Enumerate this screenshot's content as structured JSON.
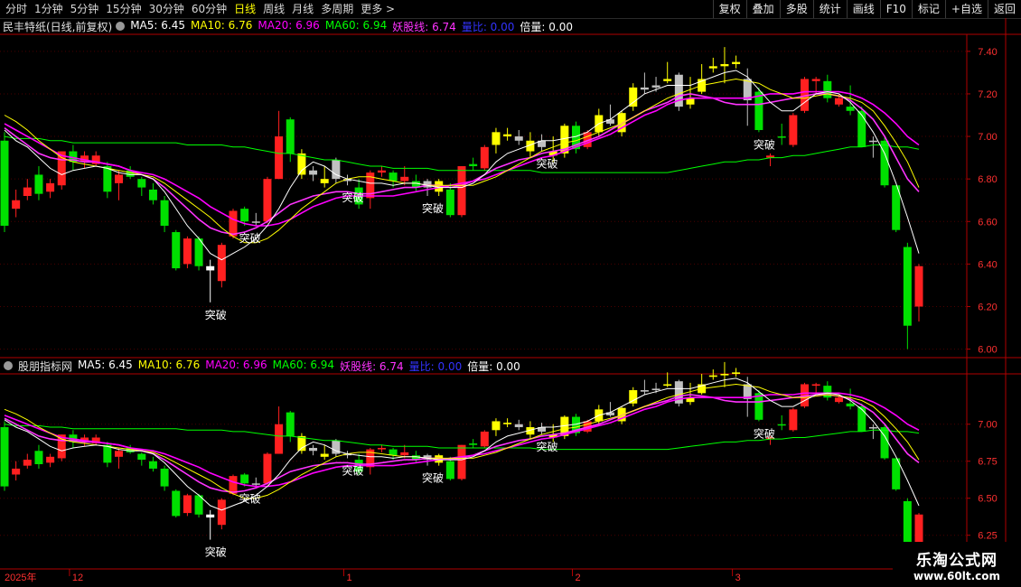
{
  "toolbar": {
    "periods": [
      "分时",
      "1分钟",
      "5分钟",
      "15分钟",
      "30分钟",
      "60分钟",
      "日线",
      "周线",
      "月线",
      "多周期",
      "更多 >"
    ],
    "active_period": "日线",
    "right_buttons": [
      "复权",
      "叠加",
      "多股",
      "统计",
      "画线",
      "F10",
      "标记",
      "+自选",
      "返回"
    ]
  },
  "main_legend": {
    "title": "民丰特纸(日线,前复权)",
    "items": [
      {
        "text": "MA5: 6.45",
        "color": "#ffffff"
      },
      {
        "text": "MA10: 6.76",
        "color": "#ffff00"
      },
      {
        "text": "MA20: 6.96",
        "color": "#ff00ff"
      },
      {
        "text": "MA60: 6.94",
        "color": "#00ff00"
      },
      {
        "text": "妖股线: 6.74",
        "color": "#ff33ff"
      },
      {
        "text": "量比: 0.00",
        "color": "#3333ff"
      },
      {
        "text": "倍量: 0.00",
        "color": "#ffffff"
      }
    ]
  },
  "sub_legend": {
    "title": "股朋指标网",
    "items": [
      {
        "text": "MA5: 6.45",
        "color": "#ffffff"
      },
      {
        "text": "MA10: 6.76",
        "color": "#ffff00"
      },
      {
        "text": "MA20: 6.96",
        "color": "#ff00ff"
      },
      {
        "text": "MA60: 6.94",
        "color": "#00ff00"
      },
      {
        "text": "妖股线: 6.74",
        "color": "#ff33ff"
      },
      {
        "text": "量比: 0.00",
        "color": "#3333ff"
      },
      {
        "text": "倍量: 0.00",
        "color": "#ffffff"
      }
    ]
  },
  "signal_label": "突破",
  "x_axis": {
    "year_label": "2025年",
    "month_labels": [
      "12",
      "1",
      "2",
      "3"
    ]
  },
  "watermark": {
    "line1": "乐淘公式网",
    "line2": "www.60lt.com"
  },
  "colors": {
    "up": "#ff2020",
    "down": "#00e000",
    "neutral": "#c0c0c0",
    "yellow": "#ffff00",
    "axis": "#b00000"
  },
  "chart_data": {
    "type": "candlestick",
    "main_axis": {
      "ticks": [
        7.4,
        7.2,
        7.0,
        6.8,
        6.6,
        6.4,
        6.2,
        6.0
      ],
      "ylim": [
        5.96,
        7.48
      ]
    },
    "sub_axis": {
      "ticks": [
        7.0,
        6.75,
        6.5,
        6.25
      ]
    },
    "price_labels": [
      "7.40",
      "7.20",
      "7.00",
      "6.80",
      "6.60",
      "6.40",
      "6.20",
      "6.00"
    ],
    "sub_price_labels": [
      "7.00",
      "6.75",
      "6.50",
      "6.25"
    ],
    "candles": [
      {
        "o": 6.98,
        "h": 7.02,
        "l": 6.55,
        "c": 6.58,
        "k": "down"
      },
      {
        "o": 6.66,
        "h": 6.75,
        "l": 6.62,
        "c": 6.7,
        "k": "up"
      },
      {
        "o": 6.76,
        "h": 6.8,
        "l": 6.7,
        "c": 6.72,
        "k": "up"
      },
      {
        "o": 6.82,
        "h": 6.86,
        "l": 6.7,
        "c": 6.73,
        "k": "down"
      },
      {
        "o": 6.74,
        "h": 6.8,
        "l": 6.71,
        "c": 6.78,
        "k": "up"
      },
      {
        "o": 6.77,
        "h": 6.93,
        "l": 6.75,
        "c": 6.93,
        "k": "up"
      },
      {
        "o": 6.93,
        "h": 6.96,
        "l": 6.84,
        "c": 6.88,
        "k": "down"
      },
      {
        "o": 6.88,
        "h": 6.93,
        "l": 6.85,
        "c": 6.91,
        "k": "up"
      },
      {
        "o": 6.91,
        "h": 6.93,
        "l": 6.86,
        "c": 6.87,
        "k": "up"
      },
      {
        "o": 6.86,
        "h": 6.88,
        "l": 6.71,
        "c": 6.74,
        "k": "down"
      },
      {
        "o": 6.78,
        "h": 6.84,
        "l": 6.7,
        "c": 6.82,
        "k": "up"
      },
      {
        "o": 6.84,
        "h": 6.86,
        "l": 6.8,
        "c": 6.81,
        "k": "down"
      },
      {
        "o": 6.8,
        "h": 6.81,
        "l": 6.72,
        "c": 6.76,
        "k": "down"
      },
      {
        "o": 6.75,
        "h": 6.78,
        "l": 6.68,
        "c": 6.7,
        "k": "down"
      },
      {
        "o": 6.7,
        "h": 6.72,
        "l": 6.55,
        "c": 6.58,
        "k": "down"
      },
      {
        "o": 6.55,
        "h": 6.56,
        "l": 6.37,
        "c": 6.38,
        "k": "down"
      },
      {
        "o": 6.4,
        "h": 6.53,
        "l": 6.38,
        "c": 6.52,
        "k": "up"
      },
      {
        "o": 6.52,
        "h": 6.53,
        "l": 6.37,
        "c": 6.39,
        "k": "down"
      },
      {
        "o": 6.39,
        "h": 6.42,
        "l": 6.22,
        "c": 6.37,
        "k": "white"
      },
      {
        "o": 6.32,
        "h": 6.5,
        "l": 6.29,
        "c": 6.49,
        "k": "up"
      },
      {
        "o": 6.53,
        "h": 6.66,
        "l": 6.52,
        "c": 6.65,
        "k": "up"
      },
      {
        "o": 6.66,
        "h": 6.67,
        "l": 6.58,
        "c": 6.6,
        "k": "down"
      },
      {
        "o": 6.6,
        "h": 6.64,
        "l": 6.58,
        "c": 6.6,
        "k": "neutral"
      },
      {
        "o": 6.6,
        "h": 6.81,
        "l": 6.59,
        "c": 6.8,
        "k": "up"
      },
      {
        "o": 6.8,
        "h": 7.12,
        "l": 6.8,
        "c": 7.0,
        "k": "up"
      },
      {
        "o": 7.08,
        "h": 7.09,
        "l": 6.88,
        "c": 6.92,
        "k": "down"
      },
      {
        "o": 6.92,
        "h": 6.94,
        "l": 6.8,
        "c": 6.82,
        "k": "yellow"
      },
      {
        "o": 6.82,
        "h": 6.86,
        "l": 6.79,
        "c": 6.84,
        "k": "neutral"
      },
      {
        "o": 6.8,
        "h": 6.86,
        "l": 6.76,
        "c": 6.78,
        "k": "yellow"
      },
      {
        "o": 6.89,
        "h": 6.9,
        "l": 6.78,
        "c": 6.8,
        "k": "neutral"
      },
      {
        "o": 6.79,
        "h": 6.82,
        "l": 6.77,
        "c": 6.8,
        "k": "neutral"
      },
      {
        "o": 6.76,
        "h": 6.8,
        "l": 6.66,
        "c": 6.68,
        "k": "down"
      },
      {
        "o": 6.71,
        "h": 6.84,
        "l": 6.66,
        "c": 6.83,
        "k": "up"
      },
      {
        "o": 6.84,
        "h": 6.86,
        "l": 6.81,
        "c": 6.83,
        "k": "up"
      },
      {
        "o": 6.83,
        "h": 6.84,
        "l": 6.76,
        "c": 6.79,
        "k": "down"
      },
      {
        "o": 6.81,
        "h": 6.86,
        "l": 6.77,
        "c": 6.79,
        "k": "up"
      },
      {
        "o": 6.79,
        "h": 6.82,
        "l": 6.74,
        "c": 6.76,
        "k": "down"
      },
      {
        "o": 6.76,
        "h": 6.8,
        "l": 6.72,
        "c": 6.79,
        "k": "neutral"
      },
      {
        "o": 6.79,
        "h": 6.8,
        "l": 6.72,
        "c": 6.74,
        "k": "yellow"
      },
      {
        "o": 6.75,
        "h": 6.78,
        "l": 6.62,
        "c": 6.63,
        "k": "down"
      },
      {
        "o": 6.63,
        "h": 6.86,
        "l": 6.62,
        "c": 6.86,
        "k": "up"
      },
      {
        "o": 6.87,
        "h": 6.9,
        "l": 6.84,
        "c": 6.86,
        "k": "down"
      },
      {
        "o": 6.85,
        "h": 6.96,
        "l": 6.84,
        "c": 6.95,
        "k": "up"
      },
      {
        "o": 6.96,
        "h": 7.04,
        "l": 6.92,
        "c": 7.02,
        "k": "yellow"
      },
      {
        "o": 7.01,
        "h": 7.04,
        "l": 6.98,
        "c": 7.0,
        "k": "yellow"
      },
      {
        "o": 7.0,
        "h": 7.03,
        "l": 6.96,
        "c": 6.98,
        "k": "neutral"
      },
      {
        "o": 6.98,
        "h": 7.02,
        "l": 6.9,
        "c": 6.93,
        "k": "yellow"
      },
      {
        "o": 6.95,
        "h": 7.01,
        "l": 6.93,
        "c": 6.98,
        "k": "neutral"
      },
      {
        "o": 6.93,
        "h": 7.0,
        "l": 6.88,
        "c": 6.91,
        "k": "yellow"
      },
      {
        "o": 6.92,
        "h": 7.06,
        "l": 6.9,
        "c": 7.05,
        "k": "yellow"
      },
      {
        "o": 7.05,
        "h": 7.07,
        "l": 6.92,
        "c": 6.94,
        "k": "down"
      },
      {
        "o": 6.95,
        "h": 7.03,
        "l": 6.94,
        "c": 7.02,
        "k": "up"
      },
      {
        "o": 7.02,
        "h": 7.13,
        "l": 7.0,
        "c": 7.1,
        "k": "yellow"
      },
      {
        "o": 7.08,
        "h": 7.15,
        "l": 7.05,
        "c": 7.06,
        "k": "neutral"
      },
      {
        "o": 7.02,
        "h": 7.12,
        "l": 7.0,
        "c": 7.11,
        "k": "yellow"
      },
      {
        "o": 7.14,
        "h": 7.25,
        "l": 7.12,
        "c": 7.23,
        "k": "yellow"
      },
      {
        "o": 7.23,
        "h": 7.3,
        "l": 7.2,
        "c": 7.22,
        "k": "neutral"
      },
      {
        "o": 7.23,
        "h": 7.28,
        "l": 7.21,
        "c": 7.24,
        "k": "neutral"
      },
      {
        "o": 7.26,
        "h": 7.35,
        "l": 7.25,
        "c": 7.27,
        "k": "yellow"
      },
      {
        "o": 7.29,
        "h": 7.3,
        "l": 7.12,
        "c": 7.14,
        "k": "neutral"
      },
      {
        "o": 7.15,
        "h": 7.28,
        "l": 7.13,
        "c": 7.18,
        "k": "yellow"
      },
      {
        "o": 7.21,
        "h": 7.34,
        "l": 7.2,
        "c": 7.27,
        "k": "yellow"
      },
      {
        "o": 7.32,
        "h": 7.37,
        "l": 7.3,
        "c": 7.33,
        "k": "yellow"
      },
      {
        "o": 7.33,
        "h": 7.42,
        "l": 7.25,
        "c": 7.34,
        "k": "yellow"
      },
      {
        "o": 7.34,
        "h": 7.38,
        "l": 7.32,
        "c": 7.35,
        "k": "yellow"
      },
      {
        "o": 7.27,
        "h": 7.32,
        "l": 7.05,
        "c": 7.17,
        "k": "neutral"
      },
      {
        "o": 7.21,
        "h": 7.23,
        "l": 7.02,
        "c": 7.03,
        "k": "down"
      },
      {
        "o": 6.91,
        "h": 6.92,
        "l": 6.86,
        "c": 6.9,
        "k": "up"
      },
      {
        "o": 7.0,
        "h": 7.06,
        "l": 6.96,
        "c": 7.0,
        "k": "down"
      },
      {
        "o": 6.96,
        "h": 7.11,
        "l": 6.95,
        "c": 7.1,
        "k": "up"
      },
      {
        "o": 7.12,
        "h": 7.28,
        "l": 7.11,
        "c": 7.27,
        "k": "up"
      },
      {
        "o": 7.26,
        "h": 7.28,
        "l": 7.2,
        "c": 7.27,
        "k": "up"
      },
      {
        "o": 7.26,
        "h": 7.29,
        "l": 7.16,
        "c": 7.18,
        "k": "down"
      },
      {
        "o": 7.18,
        "h": 7.2,
        "l": 7.14,
        "c": 7.15,
        "k": "up"
      },
      {
        "o": 7.14,
        "h": 7.24,
        "l": 7.1,
        "c": 7.12,
        "k": "down"
      },
      {
        "o": 7.12,
        "h": 7.14,
        "l": 6.95,
        "c": 6.95,
        "k": "down"
      },
      {
        "o": 6.98,
        "h": 7.0,
        "l": 6.9,
        "c": 6.98,
        "k": "neutral"
      },
      {
        "o": 6.98,
        "h": 7.0,
        "l": 6.76,
        "c": 6.77,
        "k": "down"
      },
      {
        "o": 6.77,
        "h": 6.77,
        "l": 6.55,
        "c": 6.56,
        "k": "down"
      },
      {
        "o": 6.48,
        "h": 6.5,
        "l": 6.0,
        "c": 6.11,
        "k": "down"
      },
      {
        "o": 6.2,
        "h": 6.4,
        "l": 6.13,
        "c": 6.39,
        "k": "up"
      }
    ],
    "signals_at_candle": [
      18,
      21,
      30,
      37,
      47,
      66
    ],
    "lines": {
      "ma5": {
        "color": "#ffffff",
        "values": [
          7.03,
          6.98,
          6.95,
          6.9,
          6.85,
          6.82,
          6.84,
          6.85,
          6.86,
          6.85,
          6.83,
          6.82,
          6.82,
          6.8,
          6.74,
          6.66,
          6.58,
          6.52,
          6.45,
          6.42,
          6.45,
          6.48,
          6.52,
          6.58,
          6.66,
          6.76,
          6.84,
          6.88,
          6.86,
          6.82,
          6.8,
          6.79,
          6.78,
          6.78,
          6.77,
          6.78,
          6.78,
          6.77,
          6.76,
          6.76,
          6.76,
          6.78,
          6.82,
          6.88,
          6.92,
          6.94,
          6.96,
          6.98,
          6.98,
          6.99,
          7.0,
          7.02,
          7.06,
          7.08,
          7.12,
          7.16,
          7.2,
          7.22,
          7.24,
          7.24,
          7.24,
          7.26,
          7.28,
          7.3,
          7.31,
          7.28,
          7.22,
          7.16,
          7.12,
          7.12,
          7.16,
          7.2,
          7.21,
          7.2,
          7.16,
          7.1,
          7.02,
          6.92,
          6.78,
          6.62,
          6.45
        ]
      },
      "ma10": {
        "color": "#ffff00",
        "values": [
          7.1,
          7.07,
          7.03,
          6.98,
          6.94,
          6.9,
          6.88,
          6.87,
          6.86,
          6.85,
          6.84,
          6.83,
          6.82,
          6.81,
          6.78,
          6.74,
          6.7,
          6.66,
          6.62,
          6.57,
          6.53,
          6.5,
          6.5,
          6.52,
          6.56,
          6.61,
          6.66,
          6.7,
          6.74,
          6.78,
          6.8,
          6.81,
          6.81,
          6.8,
          6.79,
          6.78,
          6.78,
          6.77,
          6.77,
          6.77,
          6.77,
          6.77,
          6.79,
          6.81,
          6.84,
          6.87,
          6.9,
          6.93,
          6.95,
          6.97,
          6.98,
          7.0,
          7.02,
          7.04,
          7.06,
          7.09,
          7.12,
          7.15,
          7.18,
          7.2,
          7.22,
          7.24,
          7.25,
          7.26,
          7.27,
          7.26,
          7.25,
          7.22,
          7.2,
          7.18,
          7.18,
          7.19,
          7.2,
          7.19,
          7.18,
          7.16,
          7.12,
          7.05,
          6.97,
          6.88,
          6.76
        ]
      },
      "ma20": {
        "color": "#ff00ff",
        "values": [
          7.06,
          7.03,
          7.0,
          6.97,
          6.94,
          6.91,
          6.9,
          6.89,
          6.88,
          6.87,
          6.86,
          6.84,
          6.83,
          6.82,
          6.8,
          6.77,
          6.74,
          6.71,
          6.67,
          6.64,
          6.61,
          6.59,
          6.58,
          6.58,
          6.59,
          6.61,
          6.64,
          6.67,
          6.69,
          6.71,
          6.72,
          6.72,
          6.72,
          6.72,
          6.72,
          6.73,
          6.74,
          6.75,
          6.76,
          6.77,
          6.78,
          6.79,
          6.8,
          6.82,
          6.84,
          6.86,
          6.88,
          6.9,
          6.91,
          6.93,
          6.95,
          6.97,
          6.99,
          7.01,
          7.04,
          7.07,
          7.1,
          7.12,
          7.15,
          7.17,
          7.18,
          7.18,
          7.18,
          7.18,
          7.18,
          7.18,
          7.19,
          7.2,
          7.2,
          7.2,
          7.21,
          7.21,
          7.21,
          7.21,
          7.2,
          7.18,
          7.15,
          7.11,
          7.06,
          7.0,
          6.96
        ]
      },
      "ma60": {
        "color": "#00ff00",
        "values": [
          7.0,
          6.99,
          6.99,
          6.99,
          6.98,
          6.98,
          6.97,
          6.97,
          6.97,
          6.97,
          6.97,
          6.97,
          6.97,
          6.97,
          6.97,
          6.97,
          6.96,
          6.96,
          6.96,
          6.96,
          6.95,
          6.95,
          6.94,
          6.93,
          6.92,
          6.92,
          6.91,
          6.9,
          6.89,
          6.89,
          6.88,
          6.87,
          6.86,
          6.86,
          6.85,
          6.85,
          6.85,
          6.85,
          6.84,
          6.84,
          6.84,
          6.84,
          6.84,
          6.84,
          6.84,
          6.84,
          6.84,
          6.83,
          6.83,
          6.83,
          6.83,
          6.83,
          6.83,
          6.83,
          6.83,
          6.83,
          6.83,
          6.83,
          6.83,
          6.84,
          6.85,
          6.86,
          6.87,
          6.88,
          6.88,
          6.89,
          6.89,
          6.9,
          6.9,
          6.91,
          6.91,
          6.92,
          6.93,
          6.94,
          6.95,
          6.95,
          6.96,
          6.96,
          6.95,
          6.95,
          6.94
        ]
      },
      "yaogu": {
        "color": "#ff33ff",
        "values": [
          7.04,
          7.0,
          6.96,
          6.92,
          6.9,
          6.89,
          6.89,
          6.88,
          6.88,
          6.87,
          6.86,
          6.84,
          6.82,
          6.8,
          6.76,
          6.71,
          6.66,
          6.61,
          6.57,
          6.55,
          6.54,
          6.55,
          6.57,
          6.6,
          6.64,
          6.68,
          6.7,
          6.72,
          6.73,
          6.74,
          6.74,
          6.73,
          6.73,
          6.74,
          6.75,
          6.76,
          6.76,
          6.77,
          6.77,
          6.76,
          6.77,
          6.79,
          6.82,
          6.85,
          6.87,
          6.89,
          6.9,
          6.92,
          6.93,
          6.94,
          6.96,
          6.98,
          7.0,
          7.03,
          7.06,
          7.09,
          7.12,
          7.14,
          7.16,
          7.19,
          7.2,
          7.19,
          7.18,
          7.16,
          7.15,
          7.15,
          7.15,
          7.16,
          7.17,
          7.18,
          7.19,
          7.2,
          7.2,
          7.19,
          7.17,
          7.13,
          7.08,
          7.0,
          6.9,
          6.8,
          6.74
        ]
      }
    }
  }
}
